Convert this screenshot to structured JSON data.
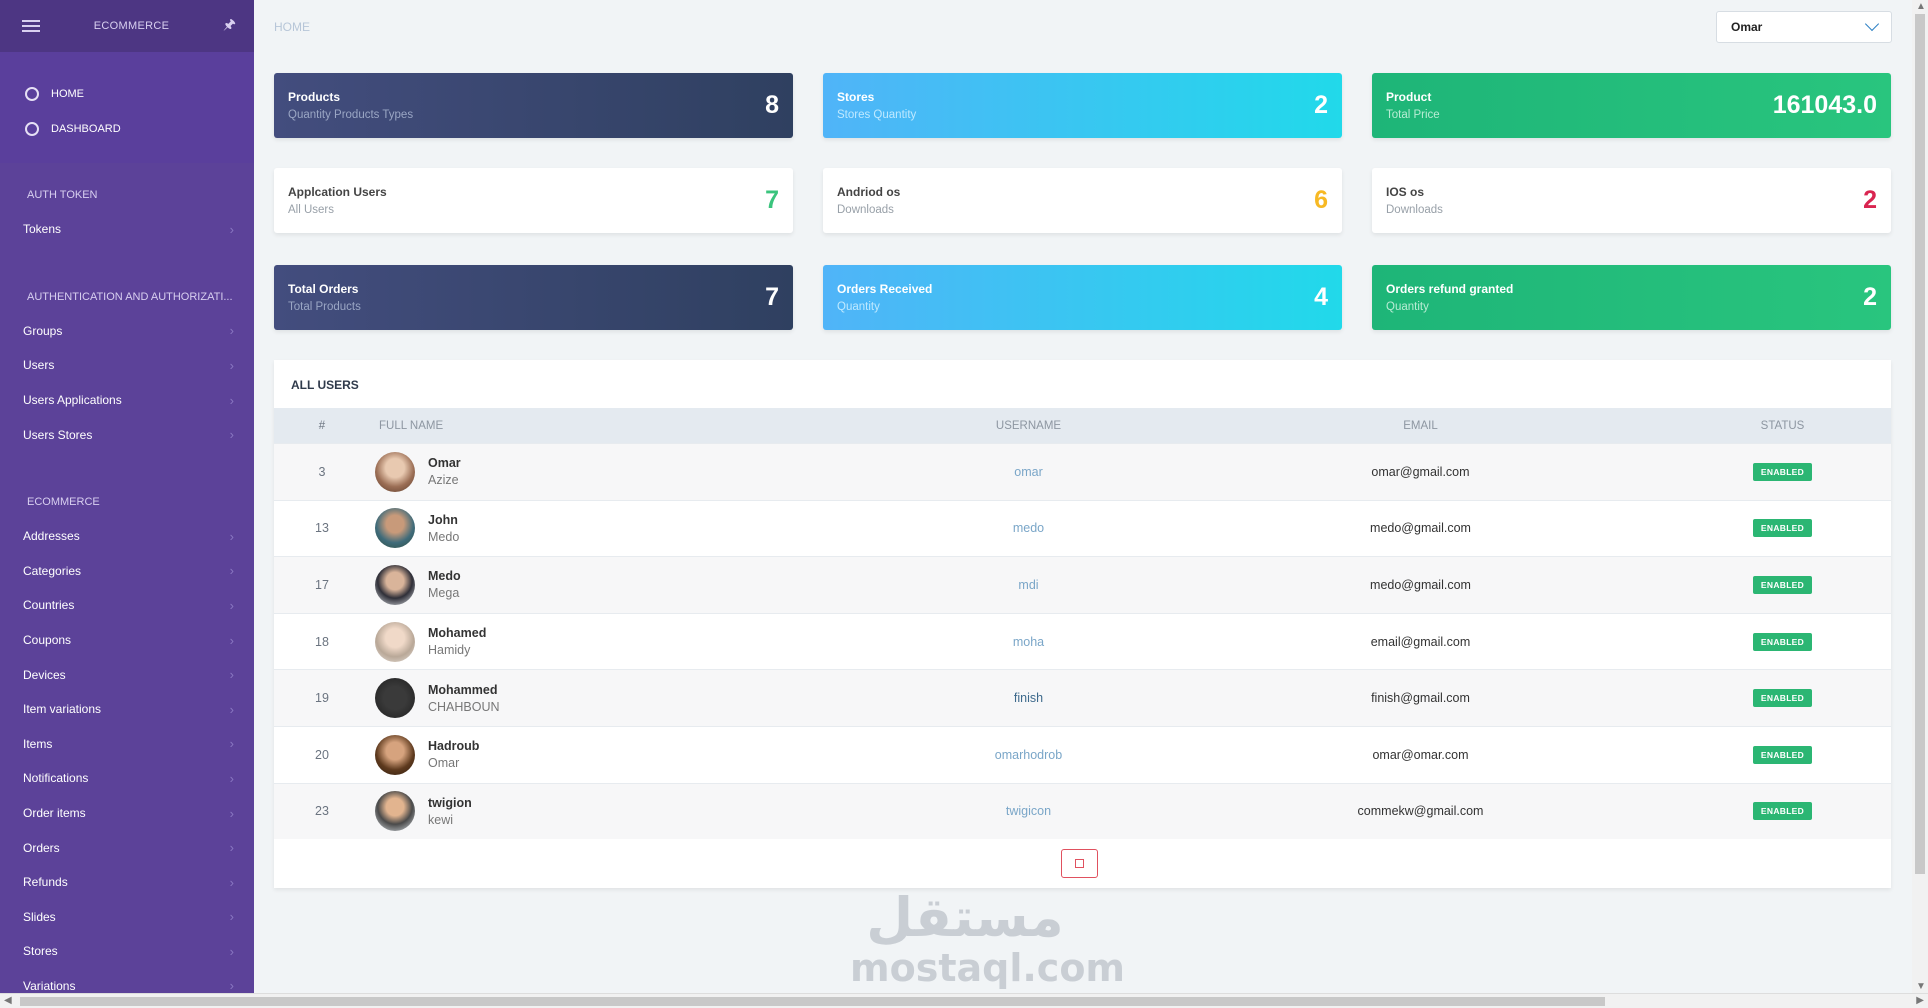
{
  "sidebar": {
    "brand": "ECOMMERCE",
    "top_items": [
      {
        "label": "HOME"
      },
      {
        "label": "DASHBOARD"
      }
    ],
    "sections": [
      {
        "title": "AUTH TOKEN",
        "items": [
          "Tokens"
        ]
      },
      {
        "title": "AUTHENTICATION AND AUTHORIZATI...",
        "items": [
          "Groups",
          "Users",
          "Users Applications",
          "Users Stores"
        ]
      },
      {
        "title": "ECOMMERCE",
        "items": [
          "Addresses",
          "Categories",
          "Countries",
          "Coupons",
          "Devices",
          "Item variations",
          "Items",
          "Notifications",
          "Order items",
          "Orders",
          "Refunds",
          "Slides",
          "Stores",
          "Variations"
        ]
      }
    ]
  },
  "header": {
    "breadcrumb": "HOME",
    "user_select": "Omar"
  },
  "cards": [
    {
      "title": "Products",
      "subtitle": "Quantity Products Types",
      "value": "8",
      "style": "dark"
    },
    {
      "title": "Stores",
      "subtitle": "Stores Quantity",
      "value": "2",
      "style": "cyan"
    },
    {
      "title": "Product",
      "subtitle": "Total Price",
      "value": "161043.0",
      "style": "green"
    },
    {
      "title": "Applcation Users",
      "subtitle": "All Users",
      "value": "7",
      "style": "white",
      "value_color": "#3ac47d"
    },
    {
      "title": "Andriod os",
      "subtitle": "Downloads",
      "value": "6",
      "style": "white",
      "value_color": "#f7b924"
    },
    {
      "title": "IOS os",
      "subtitle": "Downloads",
      "value": "2",
      "style": "white",
      "value_color": "#d92550"
    },
    {
      "title": "Total Orders",
      "subtitle": "Total Products",
      "value": "7",
      "style": "dark"
    },
    {
      "title": "Orders Received",
      "subtitle": "Quantity",
      "value": "4",
      "style": "cyan"
    },
    {
      "title": "Orders refund granted",
      "subtitle": "Quantity",
      "value": "2",
      "style": "green"
    }
  ],
  "users_table": {
    "title": "ALL USERS",
    "columns": [
      "#",
      "FULL NAME",
      "USERNAME",
      "EMAIL",
      "STATUS"
    ],
    "rows": [
      {
        "id": "3",
        "first": "Omar",
        "last": "Azize",
        "username": "omar",
        "email": "omar@gmail.com",
        "status": "ENABLED"
      },
      {
        "id": "13",
        "first": "John",
        "last": "Medo",
        "username": "medo",
        "email": "medo@gmail.com",
        "status": "ENABLED"
      },
      {
        "id": "17",
        "first": "Medo",
        "last": "Mega",
        "username": "mdi",
        "email": "medo@gmail.com",
        "status": "ENABLED"
      },
      {
        "id": "18",
        "first": "Mohamed",
        "last": "Hamidy",
        "username": "moha",
        "email": "email@gmail.com",
        "status": "ENABLED"
      },
      {
        "id": "19",
        "first": "Mohammed",
        "last": "CHAHBOUN",
        "username": "finish",
        "email": "finish@gmail.com",
        "status": "ENABLED"
      },
      {
        "id": "20",
        "first": "Hadroub",
        "last": "Omar",
        "username": "omarhodrob",
        "email": "omar@omar.com",
        "status": "ENABLED"
      },
      {
        "id": "23",
        "first": "twigion",
        "last": "kewi",
        "username": "twigicon",
        "email": "commekw@gmail.com",
        "status": "ENABLED"
      }
    ]
  },
  "watermark": {
    "arabic": "مستقل",
    "latin": "mostaql.com"
  },
  "colors": {
    "sidebar": "#5c4299",
    "accent_green": "#2bb673",
    "accent_cyan": "#21d9ea",
    "accent_dark": "#2f4060"
  }
}
